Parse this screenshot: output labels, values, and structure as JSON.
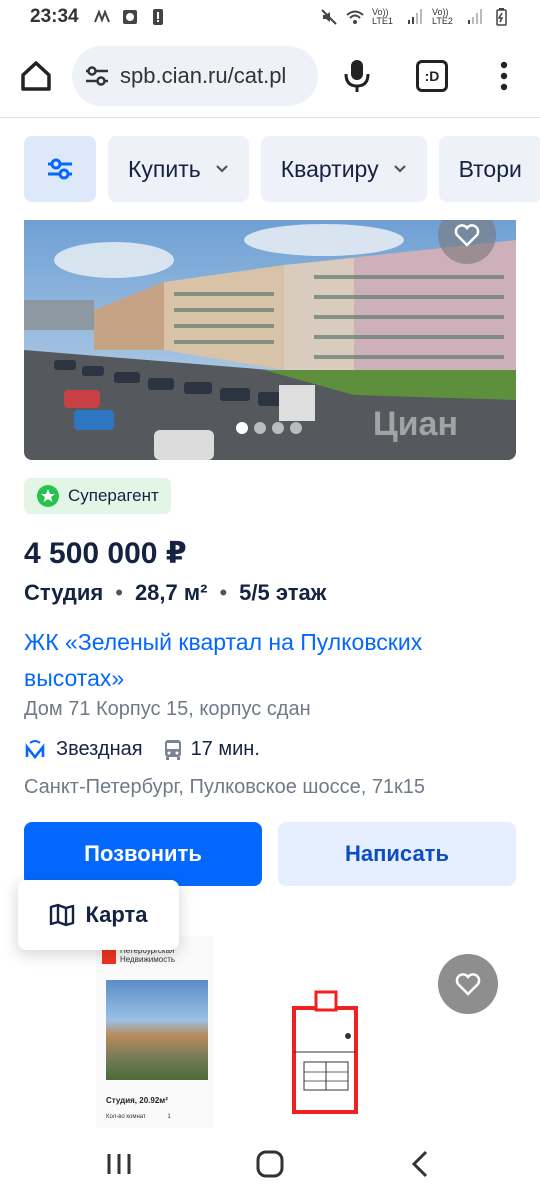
{
  "status_bar": {
    "time": "23:34",
    "sim1_label": "Vo)) LTE1",
    "sim2_label": "Vo)) LTE2"
  },
  "browser": {
    "url": "spb.cian.ru/cat.pl",
    "tab_label": ":D"
  },
  "filters": {
    "buy_label": "Купить",
    "type_label": "Квартиру",
    "market_label": "Втори"
  },
  "listing": {
    "badge": "Суперагент",
    "price": "4 500 000 ₽",
    "rooms": "Студия",
    "area": "28,7 м²",
    "floor": "5/5 этаж",
    "title": "ЖК «Зеленый квартал на Пулковских высотах»",
    "building": "Дом 71 Корпус 15, корпус сдан",
    "metro": "Звездная",
    "metro_time": "17 мин.",
    "address": "Санкт-Петербург, Пулковское шоссе, 71к15",
    "call_label": "Позвонить",
    "write_label": "Написать",
    "photo_watermark": "Циан",
    "photo_count": 4,
    "photo_active_index": 0
  },
  "map_button": {
    "label": "Карта"
  },
  "listing2": {
    "brand": "Петербургская Недвижимость",
    "caption": "Студия, 20.92м²",
    "caption2": "Кол-во комнат",
    "caption2_value": "1"
  },
  "colors": {
    "accent": "#0468ff",
    "badge_bg": "#e3f6e6",
    "badge_star": "#28c152",
    "metro": "#0468ff"
  }
}
